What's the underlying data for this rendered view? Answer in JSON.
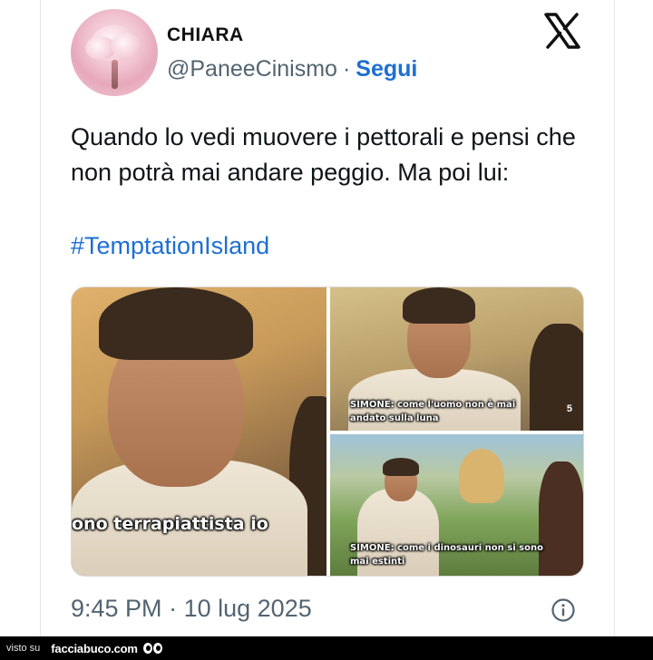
{
  "author": {
    "name": "CHIARA",
    "handle": "@PaneeCinismo",
    "separator": "·",
    "follow_label": "Segui"
  },
  "tweet": {
    "text": "Quando lo vedi muovere i pettorali e pensi che non potrà mai andare peggio. Ma poi lui:",
    "hashtag": "#TemptationIsland"
  },
  "media": {
    "panel1_subtitle": "ono terrapiattista io",
    "panel2_subtitle": "SIMONE: come l'uomo non è mai andato sulla luna",
    "panel3_subtitle": "SIMONE: come i dinosauri non si sono mai estinti",
    "channel_logo": "5"
  },
  "meta": {
    "time": "9:45 PM",
    "separator": "·",
    "date": "10 lug 2025"
  },
  "footer": {
    "visto_su": "visto su",
    "site": "facciabuco.com"
  },
  "icons": {
    "platform": "x-logo-icon",
    "info": "info-icon",
    "eyes": "eyes-icon"
  },
  "colors": {
    "link": "#1d6fd1",
    "text": "#0f1419",
    "muted": "#536471",
    "footer_bg": "#000000"
  }
}
